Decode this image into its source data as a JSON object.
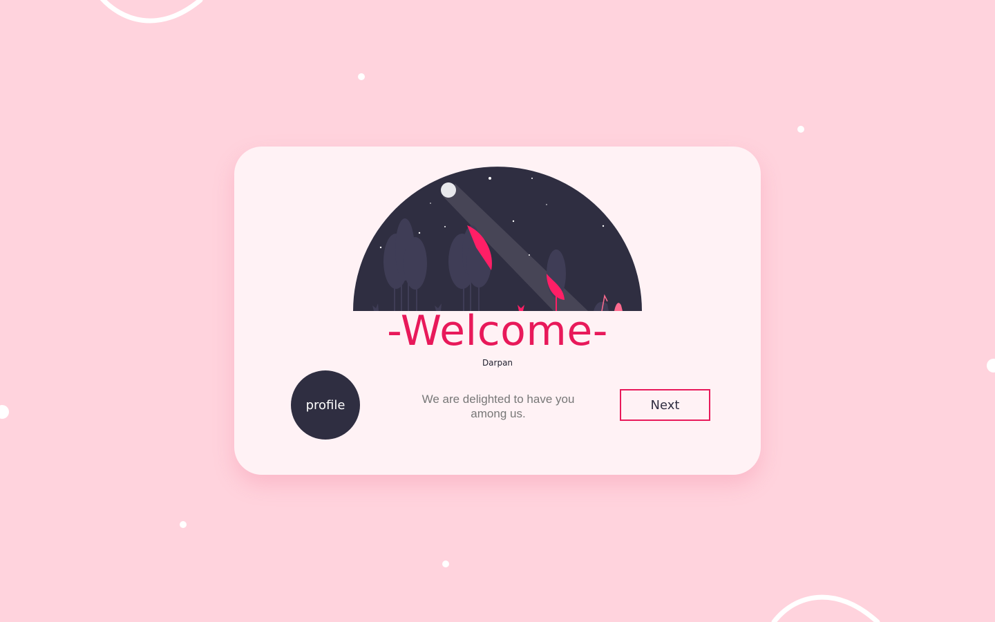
{
  "card": {
    "title": "-Welcome-",
    "user_name": "Darpan",
    "profile_label": "profile",
    "message": "We are delighted to have you among us.",
    "next_label": "Next"
  },
  "colors": {
    "background": "#ffd3dd",
    "card": "#fff2f5",
    "accent": "#e8195a",
    "dark": "#2f2e41"
  },
  "icons": [
    "night-forest-illustration",
    "moon-icon"
  ]
}
